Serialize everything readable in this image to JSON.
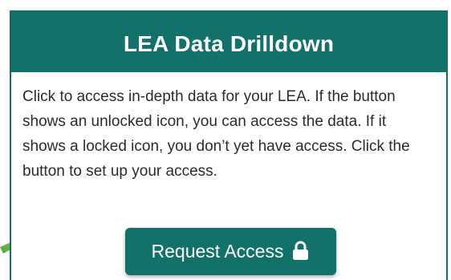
{
  "card": {
    "title": "LEA Data Drilldown",
    "description": "Click to access in-depth data for your LEA. If the button shows an unlocked icon, you can access the data. If it shows a locked icon, you don’t yet have access. Click the button to set up your access.",
    "button_label": "Request Access",
    "button_icon": "lock-icon"
  },
  "colors": {
    "header_bg": "#127168",
    "button_bg": "#127168",
    "border": "#116e67",
    "arrow": "#6cc04a",
    "text": "#2b2b2b"
  }
}
